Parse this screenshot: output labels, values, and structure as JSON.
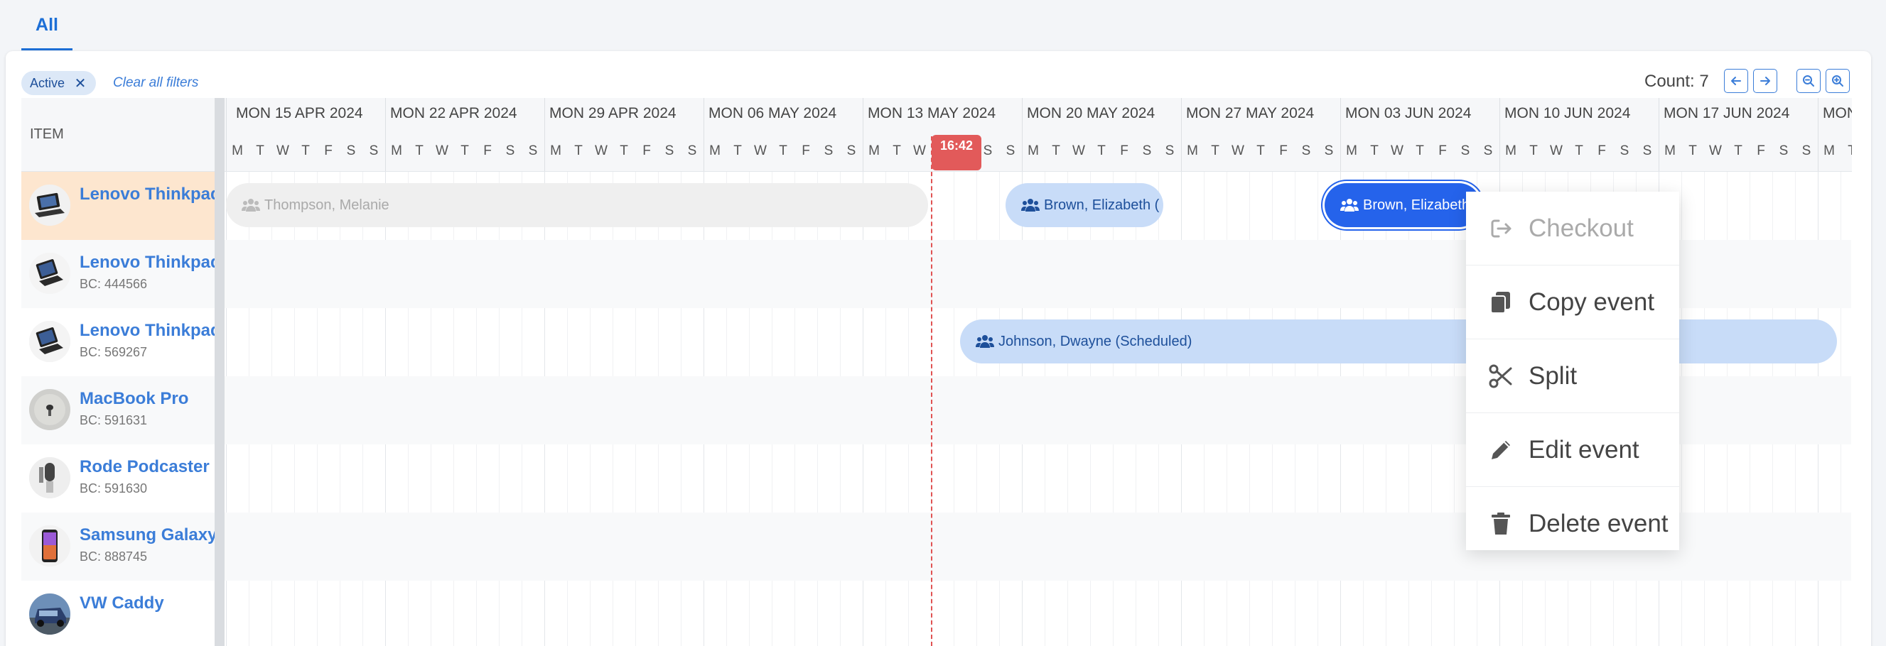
{
  "tabs": [
    {
      "label": "All"
    }
  ],
  "filters": {
    "active_chip": "Active",
    "clear_label": "Clear all filters"
  },
  "toolbar": {
    "count_label": "Count: 7"
  },
  "sidebar": {
    "header": "ITEM",
    "items": [
      {
        "name": "Lenovo Thinkpad",
        "bc": ""
      },
      {
        "name": "Lenovo Thinkpad",
        "bc": "BC: 444566"
      },
      {
        "name": "Lenovo Thinkpad",
        "bc": "BC: 569267"
      },
      {
        "name": "MacBook Pro",
        "bc": "BC: 591631"
      },
      {
        "name": "Rode Podcaster M",
        "bc": "BC: 591630"
      },
      {
        "name": "Samsung Galaxy A",
        "bc": "BC: 888745"
      },
      {
        "name": "VW Caddy",
        "bc": ""
      }
    ]
  },
  "timeline": {
    "weeks": [
      "MON 15 APR 2024",
      "MON 22 APR 2024",
      "MON 29 APR 2024",
      "MON 06 MAY 2024",
      "MON 13 MAY 2024",
      "MON 20 MAY 2024",
      "MON 27 MAY 2024",
      "MON 03 JUN 2024",
      "MON 10 JUN 2024",
      "MON 17 JUN 2024",
      "MON"
    ],
    "day_letters": [
      "M",
      "T",
      "W",
      "T",
      "F",
      "S",
      "S"
    ],
    "now_label": "16:42"
  },
  "events": [
    {
      "label": "Thompson, Melanie",
      "state": "past"
    },
    {
      "label": "Brown, Elizabeth (",
      "state": "scheduled"
    },
    {
      "label": "Brown, Elizabeth",
      "state": "selected"
    },
    {
      "label": "Johnson, Dwayne (Scheduled)",
      "state": "scheduled"
    }
  ],
  "context_menu": {
    "items": [
      {
        "label": "Checkout",
        "icon": "checkout-icon",
        "disabled": true
      },
      {
        "label": "Copy event",
        "icon": "copy-icon",
        "disabled": false
      },
      {
        "label": "Split",
        "icon": "scissors-icon",
        "disabled": false
      },
      {
        "label": "Edit event",
        "icon": "pencil-icon",
        "disabled": false
      },
      {
        "label": "Delete event",
        "icon": "trash-icon",
        "disabled": false
      }
    ]
  },
  "colors": {
    "accent": "#1d6fd6",
    "now_marker": "#e25a5a",
    "selected_row": "#fde6cf",
    "event_light": "#c8dcf8",
    "event_active": "#2563eb"
  }
}
